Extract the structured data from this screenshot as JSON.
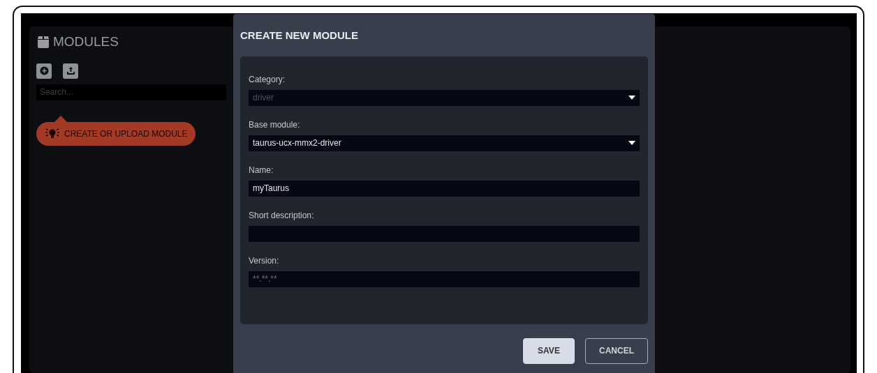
{
  "sidebar": {
    "title": "MODULES",
    "search": {
      "placeholder": "Search..."
    },
    "hint": "CREATE OR UPLOAD MODULE"
  },
  "dialog": {
    "title": "CREATE NEW MODULE",
    "fields": [
      {
        "kind": "select",
        "label": "Category:",
        "value": "driver",
        "disabled": true
      },
      {
        "kind": "select",
        "label": "Base module:",
        "value": "taurus-ucx-mmx2-driver",
        "disabled": false
      },
      {
        "kind": "text",
        "label": "Name:",
        "value": "myTaurus"
      },
      {
        "kind": "text",
        "label": "Short description:"
      },
      {
        "kind": "text",
        "label": "Version:",
        "placeholder": "**.**.**"
      }
    ],
    "buttons": [
      {
        "label": "SAVE",
        "kind": "primary"
      },
      {
        "label": "CANCEL",
        "kind": "outline"
      }
    ]
  }
}
